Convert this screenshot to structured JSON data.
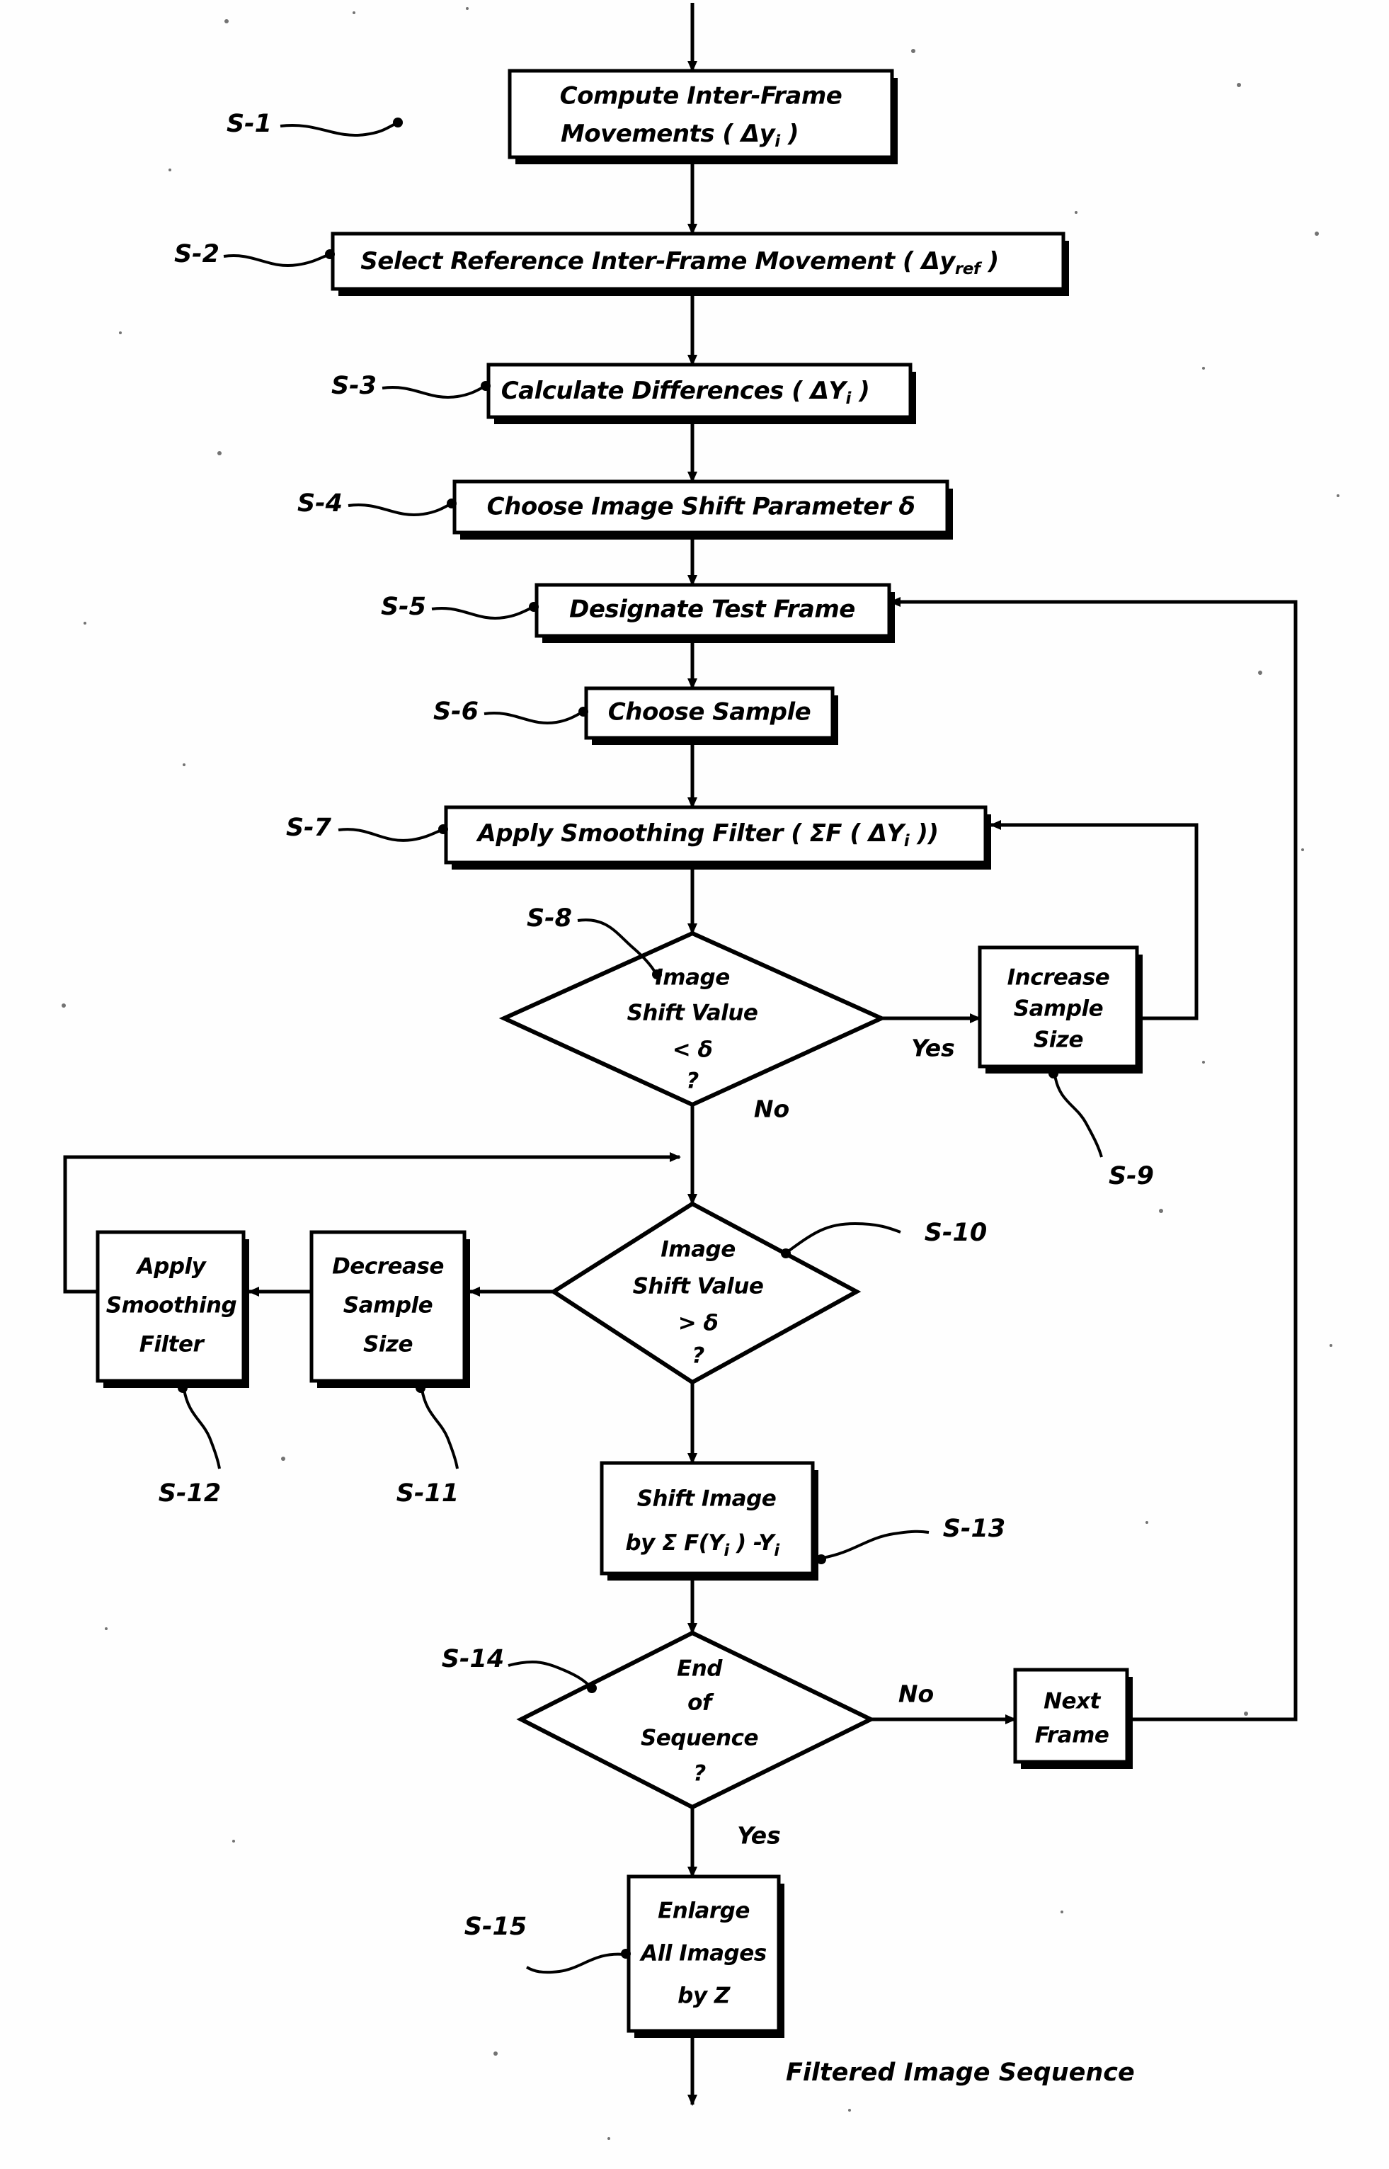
{
  "figure": {
    "type": "flowchart",
    "title": "Image stabilization flowchart",
    "output_label": "Filtered Image Sequence"
  },
  "nodes": [
    {
      "id": "S-1",
      "step": "S-1",
      "shape": "process",
      "lines": [
        "Compute Inter-Frame",
        "Movements  (Δy",
        "i",
        " )"
      ],
      "text": "Compute Inter-Frame Movements (Δyᵢ)",
      "l1": "Compute Inter-Frame",
      "l2a": "Movements  ( Δy",
      "l2b": "i",
      "l2c": " )"
    },
    {
      "id": "S-2",
      "step": "S-2",
      "shape": "process",
      "text": "Select Reference Inter-Frame Movement (Δy_ref)",
      "l1a": "Select Reference Inter-Frame Movement ( Δy",
      "l1b": "ref",
      "l1c": " )"
    },
    {
      "id": "S-3",
      "step": "S-3",
      "shape": "process",
      "text": "Calculate Differences (ΔY_i)",
      "l1a": "Calculate Differences ( ΔY",
      "l1b": "i",
      "l1c": " )"
    },
    {
      "id": "S-4",
      "step": "S-4",
      "shape": "process",
      "text": "Choose Image Shift Parameter  δ",
      "l1a": "Choose Image Shift Parameter  δ"
    },
    {
      "id": "S-5",
      "step": "S-5",
      "shape": "process",
      "text": "Designate Test Frame",
      "l1a": "Designate Test Frame"
    },
    {
      "id": "S-6",
      "step": "S-6",
      "shape": "process",
      "text": "Choose Sample",
      "l1a": "Choose Sample"
    },
    {
      "id": "S-7",
      "step": "S-7",
      "shape": "process",
      "text": "Apply Smoothing Filter ( ΣF (ΔY_i ))",
      "l1a": "Apply Smoothing Filter ( ΣF ( ΔY",
      "l1b": "i",
      "l1c": " ))"
    },
    {
      "id": "S-8",
      "step": "S-8",
      "shape": "decision",
      "lines": [
        "Image",
        "Shift Value",
        "< δ",
        "?"
      ],
      "d1": "Image",
      "d2": "Shift Value",
      "d3": "< δ",
      "d4": "?"
    },
    {
      "id": "S-9",
      "step": "S-9",
      "shape": "process",
      "lines": [
        "Increase",
        "Sample",
        "Size"
      ],
      "d1": "Increase",
      "d2": "Sample",
      "d3": "Size"
    },
    {
      "id": "S-10",
      "step": "S-10",
      "shape": "decision",
      "lines": [
        "Image",
        "Shift Value",
        "> δ",
        "?"
      ],
      "d1": "Image",
      "d2": "Shift Value",
      "d3": "> δ",
      "d4": "?"
    },
    {
      "id": "S-11",
      "step": "S-11",
      "shape": "process",
      "lines": [
        "Decrease",
        "Sample",
        "Size"
      ],
      "d1": "Decrease",
      "d2": "Sample",
      "d3": "Size"
    },
    {
      "id": "S-12",
      "step": "S-12",
      "shape": "process",
      "lines": [
        "Apply",
        "Smoothing",
        "Filter"
      ],
      "d1": "Apply",
      "d2": "Smoothing",
      "d3": "Filter"
    },
    {
      "id": "S-13",
      "step": "S-13",
      "shape": "process",
      "lines": [
        "Shift Image",
        "by Σ F(Y_i ) -Y_i"
      ],
      "d1": "Shift Image",
      "d2a": "by Σ F(Y",
      "d2b": "i",
      "d2c": " ) -Y",
      "d2d": "i"
    },
    {
      "id": "S-14",
      "step": "S-14",
      "shape": "decision",
      "lines": [
        "End",
        "of",
        "Sequence",
        "?"
      ],
      "d1": "End",
      "d2": "of",
      "d3": "Sequence",
      "d4": "?"
    },
    {
      "id": "NEXT",
      "step": "",
      "shape": "process",
      "lines": [
        "Next",
        "Frame"
      ],
      "d1": "Next",
      "d2": "Frame"
    },
    {
      "id": "S-15",
      "step": "S-15",
      "shape": "process",
      "lines": [
        "Enlarge",
        "All Images",
        "by Z"
      ],
      "d1": "Enlarge",
      "d2": "All Images",
      "d3": "by Z"
    }
  ],
  "edge_labels": {
    "s8_yes": "Yes",
    "s8_no": "No",
    "s14_no": "No",
    "s14_yes": "Yes"
  },
  "step_labels": {
    "s1": "S-1",
    "s2": "S-2",
    "s3": "S-3",
    "s4": "S-4",
    "s5": "S-5",
    "s6": "S-6",
    "s7": "S-7",
    "s8": "S-8",
    "s9": "S-9",
    "s10": "S-10",
    "s11": "S-11",
    "s12": "S-12",
    "s13": "S-13",
    "s14": "S-14",
    "s15": "S-15"
  },
  "colors": {
    "ink": "#000000",
    "paper": "#ffffff"
  }
}
